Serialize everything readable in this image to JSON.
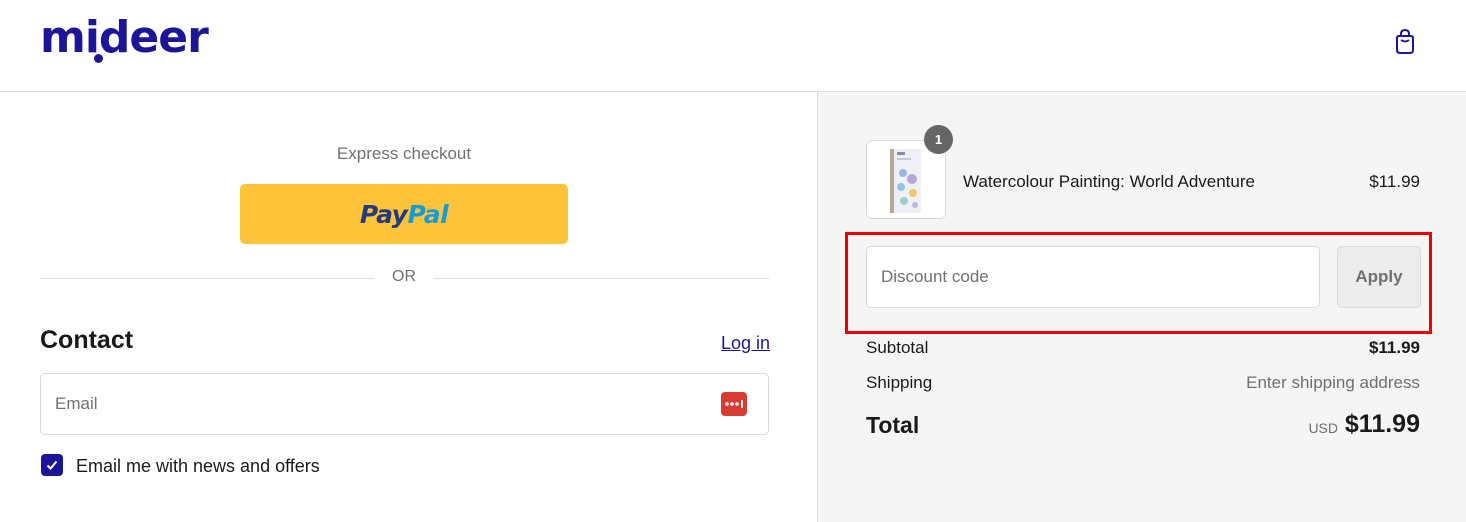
{
  "brand": {
    "name": "mideer",
    "color": "#1c1599",
    "cart_icon": "shopping-bag-icon"
  },
  "express": {
    "label": "Express checkout",
    "paypal_pay": "Pay",
    "paypal_pal": "Pal",
    "button_color": "#ffc439"
  },
  "divider": {
    "text": "OR"
  },
  "contact": {
    "title": "Contact",
    "login_link": "Log in",
    "email_placeholder": "Email",
    "email_value": "",
    "password_manager_icon": "password-manager-icon",
    "newsletter_checkbox_label": "Email me with news and offers",
    "newsletter_checked": true
  },
  "order": {
    "items": [
      {
        "name": "Watercolour Painting: World Adventure",
        "price": "$11.99",
        "quantity": "1"
      }
    ],
    "discount": {
      "placeholder": "Discount code",
      "value": "",
      "apply_label": "Apply"
    },
    "highlight_color": "#ee0000",
    "subtotal_label": "Subtotal",
    "subtotal_value": "$11.99",
    "shipping_label": "Shipping",
    "shipping_value": "Enter shipping address",
    "total_label": "Total",
    "currency": "USD",
    "total_value": "$11.99"
  }
}
